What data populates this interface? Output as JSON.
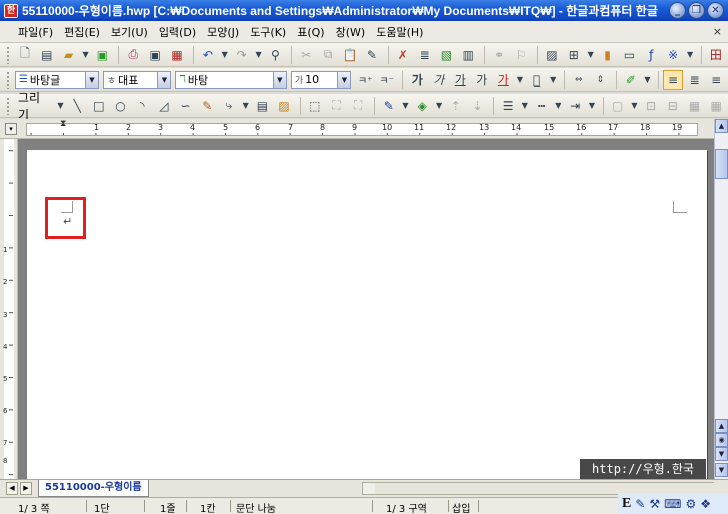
{
  "window": {
    "title": "55110000-우형이름.hwp [C:₩Documents and Settings₩Administrator₩My Documents₩ITQ₩] - 한글과컴퓨터 한글",
    "app_icon": "hwp-app-icon",
    "buttons": [
      "_",
      "❐",
      "✕"
    ]
  },
  "menu": {
    "items": [
      "파일(F)",
      "편집(E)",
      "보기(U)",
      "입력(D)",
      "모양(J)",
      "도구(K)",
      "표(Q)",
      "창(W)",
      "도움말(H)"
    ],
    "close_label": "×"
  },
  "format_toolbar": {
    "style_value": "바탕글",
    "lang_value": "대표",
    "font_value": "바탕",
    "size_value": "10",
    "bold": "가",
    "italic": "가",
    "underline": "가",
    "strike": "가",
    "color": "가"
  },
  "draw_toolbar": {
    "label": "그리기"
  },
  "ruler": {
    "numbers": [
      "1",
      "2",
      "3",
      "4",
      "5",
      "6",
      "7",
      "8",
      "9",
      "10",
      "11",
      "12",
      "13",
      "14",
      "15",
      "16",
      "17",
      "18",
      "19"
    ]
  },
  "vruler": {
    "numbers": [
      "1",
      "2",
      "3",
      "4",
      "5",
      "6",
      "7",
      "8",
      "9"
    ]
  },
  "document": {
    "paragraph_mark": "↵"
  },
  "tabs": {
    "active": "55110000-우형이름"
  },
  "status": {
    "page": "1/   3 쪽",
    "column": "1단",
    "line": "1줄",
    "col": "1칸",
    "break": "문단 나눔",
    "section": "1/   3 구역",
    "mode": "삽입"
  },
  "watermark": "http://우형.한국"
}
